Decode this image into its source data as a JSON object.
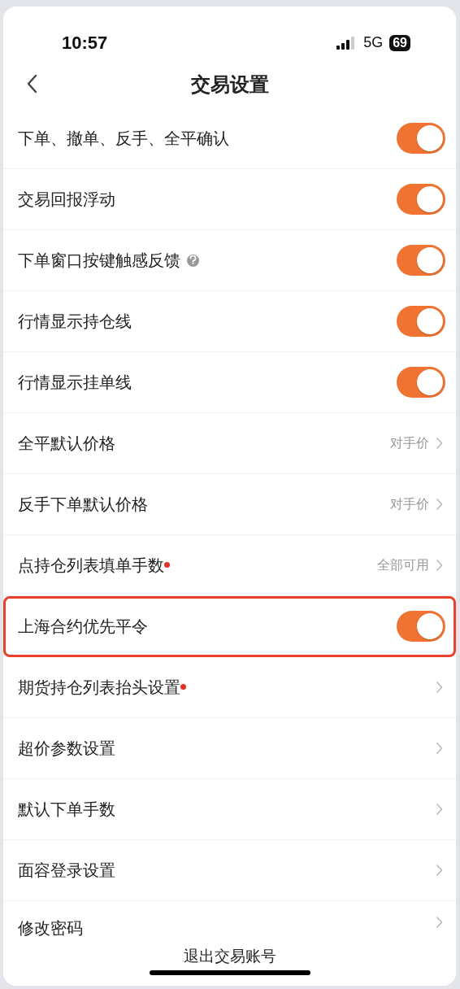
{
  "status_bar": {
    "time": "10:57",
    "network": "5G",
    "battery": "69"
  },
  "header": {
    "title": "交易设置"
  },
  "rows": [
    {
      "kind": "toggle",
      "label": "下单、撤单、反手、全平确认",
      "on": true
    },
    {
      "kind": "toggle",
      "label": "交易回报浮动",
      "on": true
    },
    {
      "kind": "toggle",
      "label": "下单窗口按键触感反馈",
      "on": true,
      "help": true
    },
    {
      "kind": "toggle",
      "label": "行情显示持仓线",
      "on": true
    },
    {
      "kind": "toggle",
      "label": "行情显示挂单线",
      "on": true
    },
    {
      "kind": "link",
      "label": "全平默认价格",
      "value": "对手价"
    },
    {
      "kind": "link",
      "label": "反手下单默认价格",
      "value": "对手价"
    },
    {
      "kind": "link",
      "label": "点持仓列表填单手数",
      "value": "全部可用",
      "dot": true
    },
    {
      "kind": "toggle",
      "label": "上海合约优先平令",
      "on": true,
      "highlighted": true
    },
    {
      "kind": "link",
      "label": "期货持仓列表抬头设置",
      "dot": true
    },
    {
      "kind": "link",
      "label": "超价参数设置"
    },
    {
      "kind": "link",
      "label": "默认下单手数"
    },
    {
      "kind": "link",
      "label": "面容登录设置"
    },
    {
      "kind": "link",
      "label": "修改密码"
    }
  ],
  "footer": {
    "logout": "退出交易账号"
  }
}
